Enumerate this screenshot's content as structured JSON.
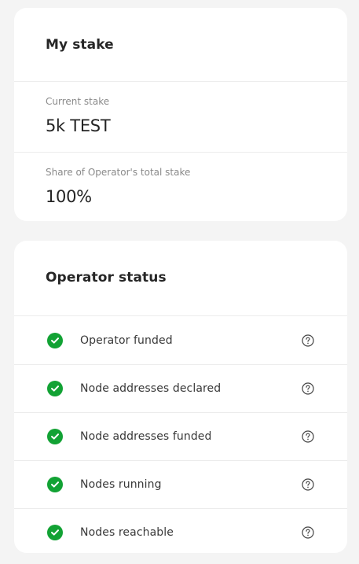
{
  "stake_card": {
    "title": "My stake",
    "current_stake_label": "Current stake",
    "current_stake_value": "5k TEST",
    "share_label": "Share of Operator's total stake",
    "share_value": "100%"
  },
  "status_card": {
    "title": "Operator status",
    "items": [
      {
        "label": "Operator funded",
        "status": "ok",
        "icon": "check-circle-icon"
      },
      {
        "label": "Node addresses declared",
        "status": "ok",
        "icon": "check-circle-icon"
      },
      {
        "label": "Node addresses funded",
        "status": "ok",
        "icon": "check-circle-icon"
      },
      {
        "label": "Nodes running",
        "status": "ok",
        "icon": "check-circle-icon"
      },
      {
        "label": "Nodes reachable",
        "status": "ok",
        "icon": "check-circle-icon"
      }
    ]
  },
  "colors": {
    "success": "#12a234",
    "card_background": "#ffffff",
    "page_background": "#f4f4f4"
  }
}
